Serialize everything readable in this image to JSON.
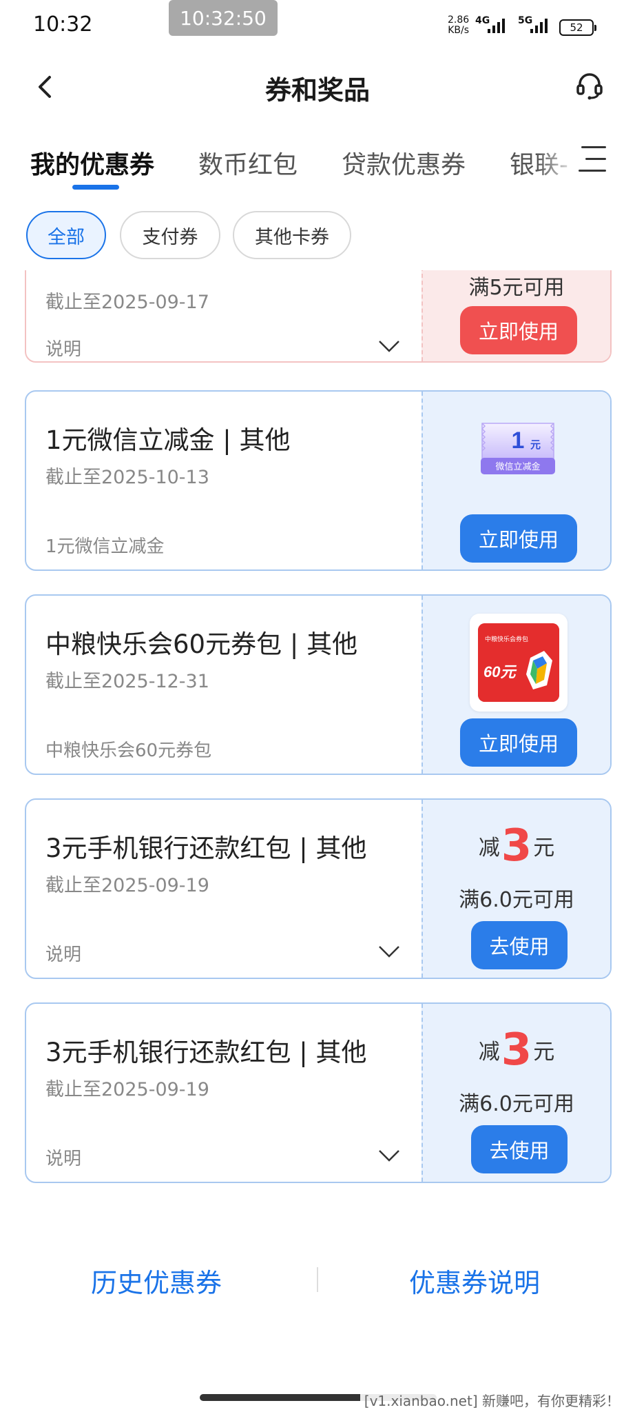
{
  "status_bar": {
    "time": "10:32",
    "recording_time": "10:32:50",
    "net_speed_value": "2.86",
    "net_speed_unit": "KB/s",
    "signal1_label": "4G",
    "signal2_label": "5G",
    "battery": "52"
  },
  "header": {
    "title": "券和奖品",
    "back_icon": "chevron-left-icon",
    "service_icon": "headset-icon"
  },
  "tabs": {
    "items": [
      {
        "label": "我的优惠券",
        "active": true
      },
      {
        "label": "数币红包"
      },
      {
        "label": "贷款优惠券"
      },
      {
        "label": "银联-"
      }
    ],
    "menu_icon": "menu-icon",
    "accent": "#1a73e8"
  },
  "filters": {
    "items": [
      {
        "label": "全部",
        "active": true
      },
      {
        "label": "支付券"
      },
      {
        "label": "其他卡券"
      }
    ]
  },
  "coupons": [
    {
      "expire": "截止至2025-09-17",
      "desc": "说明",
      "condition": "满5元可用",
      "button": "立即使用",
      "theme": "red"
    },
    {
      "title": "1元微信立减金 | 其他",
      "expire": "截止至2025-10-13",
      "desc": "1元微信立减金",
      "button": "立即使用",
      "image_amount": "1",
      "image_unit": "元",
      "image_caption": "微信立减金"
    },
    {
      "title": "中粮快乐会60元券包 | 其他",
      "expire": "截止至2025-12-31",
      "desc": "中粮快乐会60元券包",
      "button": "立即使用",
      "image_caption": "中粮快乐会券包",
      "image_amount": "60元"
    },
    {
      "title": "3元手机银行还款红包 | 其他",
      "expire": "截止至2025-09-19",
      "desc": "说明",
      "reduce_prefix": "减",
      "reduce_amount": "3",
      "reduce_unit": "元",
      "condition": "满6.0元可用",
      "button": "去使用"
    },
    {
      "title": "3元手机银行还款红包 | 其他",
      "expire": "截止至2025-09-19",
      "desc": "说明",
      "reduce_prefix": "减",
      "reduce_amount": "3",
      "reduce_unit": "元",
      "condition": "满6.0元可用",
      "button": "去使用"
    }
  ],
  "footer": {
    "history": "历史优惠券",
    "explain": "优惠券说明"
  },
  "watermark": "[v1.xianbao.net] 新赚吧，有你更精彩！"
}
